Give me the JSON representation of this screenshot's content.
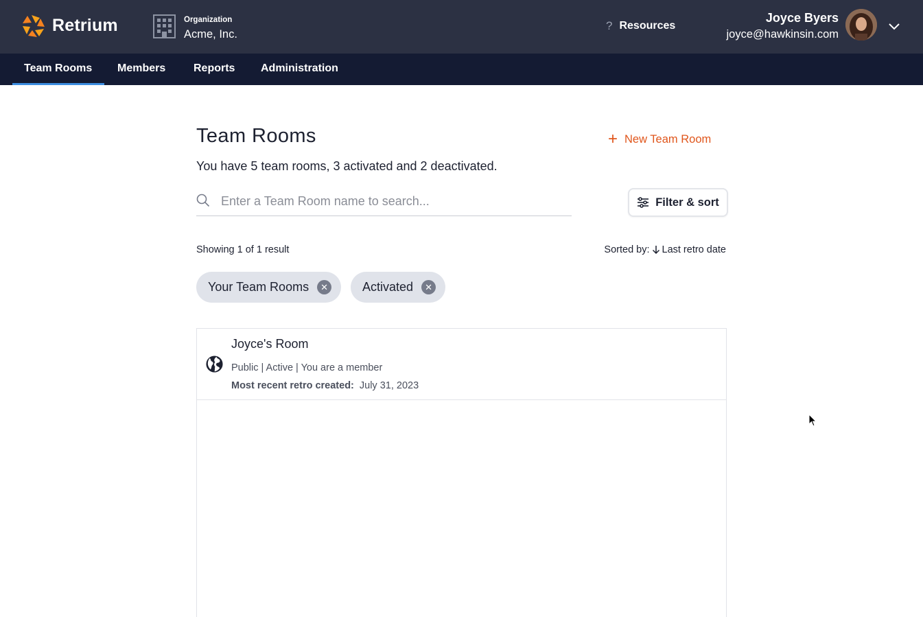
{
  "header": {
    "brand": "Retrium",
    "org_label": "Organization",
    "org_name": "Acme, Inc.",
    "resources_label": "Resources",
    "user_name": "Joyce Byers",
    "user_email": "joyce@hawkinsin.com"
  },
  "nav": {
    "items": [
      {
        "label": "Team Rooms",
        "active": true
      },
      {
        "label": "Members"
      },
      {
        "label": "Reports"
      },
      {
        "label": "Administration"
      }
    ]
  },
  "main": {
    "title": "Team Rooms",
    "new_room_label": "New Team Room",
    "summary": "You have 5 team rooms, 3 activated and 2 deactivated.",
    "search_placeholder": "Enter a Team Room name to search...",
    "filter_label": "Filter & sort",
    "showing": "Showing 1 of 1 result",
    "sorted_prefix": "Sorted by:",
    "sorted_value": "Last retro date",
    "chips": [
      {
        "label": "Your Team Rooms"
      },
      {
        "label": "Activated"
      }
    ],
    "rooms": [
      {
        "name": "Joyce's Room",
        "meta": "Public | Active | You are a member",
        "recent_label": "Most recent retro created:",
        "recent_date": "July 31, 2023",
        "icon": "globe-icon"
      }
    ]
  },
  "colors": {
    "topbar": "#2c3143",
    "navbar": "#141b33",
    "accent_orange": "#e0561c",
    "active_tab_underline": "#3d8ee0",
    "chip_bg": "#e0e3ea"
  }
}
